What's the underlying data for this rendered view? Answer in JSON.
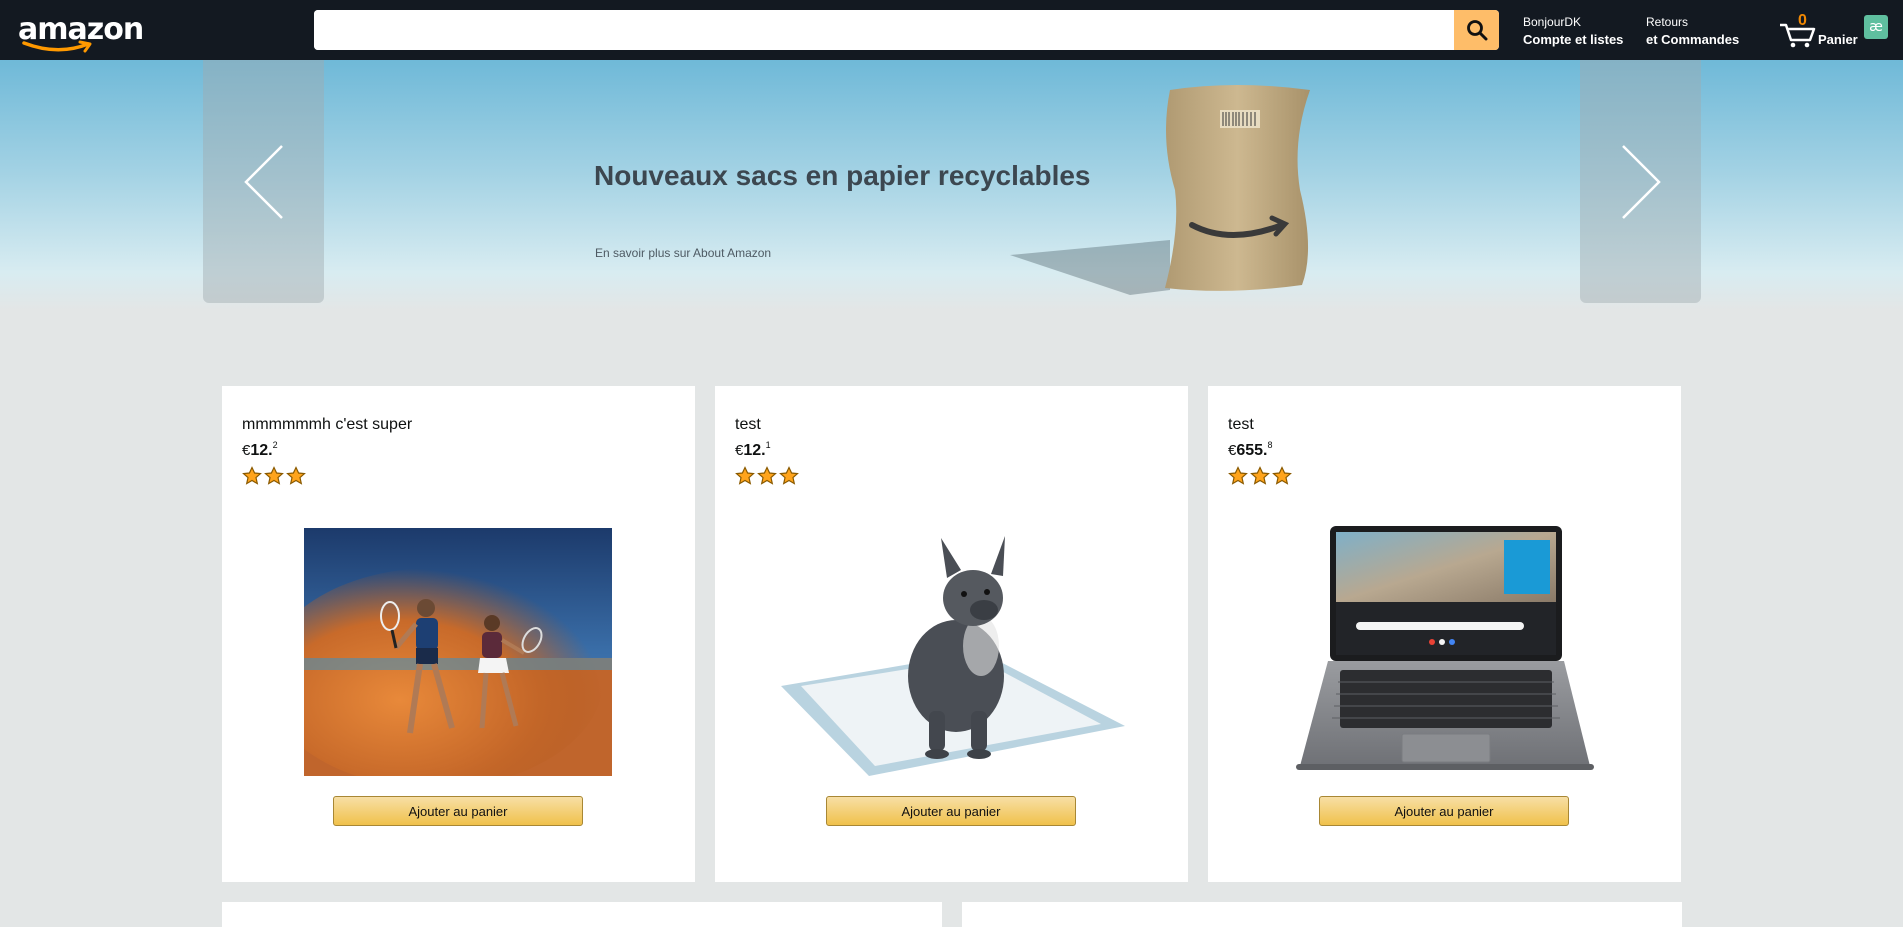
{
  "nav": {
    "logo": "amazon",
    "search_placeholder": "",
    "account_line1": "BonjourDK",
    "account_line2": "Compte et listes",
    "orders_line1": "Retours",
    "orders_line2": "et Commandes",
    "cart_count": "0",
    "cart_label": "Panier",
    "avatar_initials": "æ",
    "search_icon": "search-icon",
    "cart_icon": "cart-icon"
  },
  "hero": {
    "title": "Nouveaux sacs en papier recyclables",
    "link": "En savoir plus sur About Amazon",
    "prev_icon": "chevron-left-icon",
    "next_icon": "chevron-right-icon"
  },
  "products": [
    {
      "title": "mmmmmmh c'est super",
      "currency": "€",
      "price_whole": "12.",
      "price_fraction": "2",
      "rating": 3,
      "button": "Ajouter au panier",
      "image": "tennis-players-photo"
    },
    {
      "title": "test",
      "currency": "€",
      "price_whole": "12.",
      "price_fraction": "1",
      "rating": 3,
      "button": "Ajouter au panier",
      "image": "bulldog-on-pad-photo"
    },
    {
      "title": "test",
      "currency": "€",
      "price_whole": "655.",
      "price_fraction": "8",
      "rating": 3,
      "button": "Ajouter au panier",
      "image": "laptop-photo"
    }
  ],
  "colors": {
    "nav_bg": "#131921",
    "search_button": "#febd69",
    "cart_count": "#f08804",
    "page_bg": "#e3e6e6",
    "star": "#ffa41c",
    "button": "#f0c14b"
  }
}
